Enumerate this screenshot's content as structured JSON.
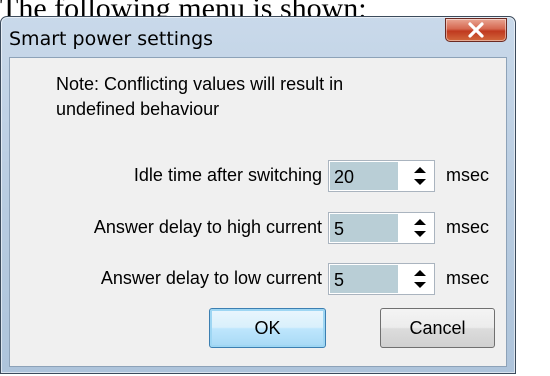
{
  "caption": "The following menu is shown:",
  "window": {
    "title": "Smart power settings",
    "close_icon": "close-x-icon"
  },
  "note": {
    "line1": "Note: Conflicting values will result in",
    "line2": "undefined behaviour"
  },
  "fields": [
    {
      "label": "Idle time after switching",
      "value": "20",
      "unit": "msec"
    },
    {
      "label": "Answer delay to high current",
      "value": "5",
      "unit": "msec"
    },
    {
      "label": "Answer delay to low current",
      "value": "5",
      "unit": "msec"
    }
  ],
  "buttons": {
    "ok": "OK",
    "cancel": "Cancel"
  },
  "colors": {
    "close_button": "#c8452a",
    "field_fill": "#b9ced6",
    "default_button_border": "#3c7fb1"
  }
}
